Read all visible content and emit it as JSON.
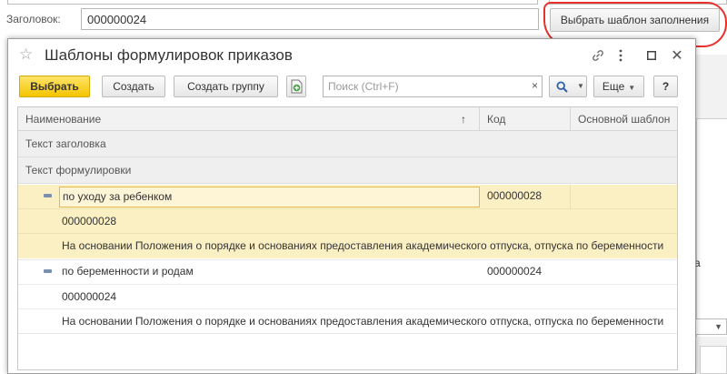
{
  "background_form": {
    "heading_label": "Заголовок:",
    "heading_value": "000000024",
    "choose_template_button": "Выбрать шаблон заполнения",
    "right_panel_letter": "а"
  },
  "modal": {
    "title": "Шаблоны формулировок приказов",
    "icons": [
      "star-icon",
      "link-icon",
      "more-icon",
      "maximize-icon",
      "close-icon"
    ]
  },
  "toolbar": {
    "select_label": "Выбрать",
    "create_label": "Создать",
    "create_group_label": "Создать группу",
    "search_placeholder": "Поиск (Ctrl+F)",
    "clear_glyph": "×",
    "more_label": "Еще",
    "help_label": "?"
  },
  "table": {
    "columns": [
      "Наименование",
      "Код",
      "Основной шаблон"
    ],
    "sort_glyph": "↑",
    "group_rows": [
      "Текст заголовка",
      "Текст формулировки"
    ],
    "rows": [
      {
        "name": "по уходу за ребенком",
        "code": "000000028",
        "heading_text": "000000028",
        "wording_text": "На основании Положения о порядке и основаниях предоставления академического отпуска, отпуска по беременности",
        "selected": true
      },
      {
        "name": "по беременности и родам",
        "code": "000000024",
        "heading_text": "000000024",
        "wording_text": "На основании Положения о порядке и основаниях предоставления академического отпуска, отпуска по беременности",
        "selected": false
      }
    ]
  },
  "colors": {
    "primary_button": "#f4c400",
    "selected_row": "#fbf0c4",
    "highlight_annotation": "#e8302c"
  }
}
